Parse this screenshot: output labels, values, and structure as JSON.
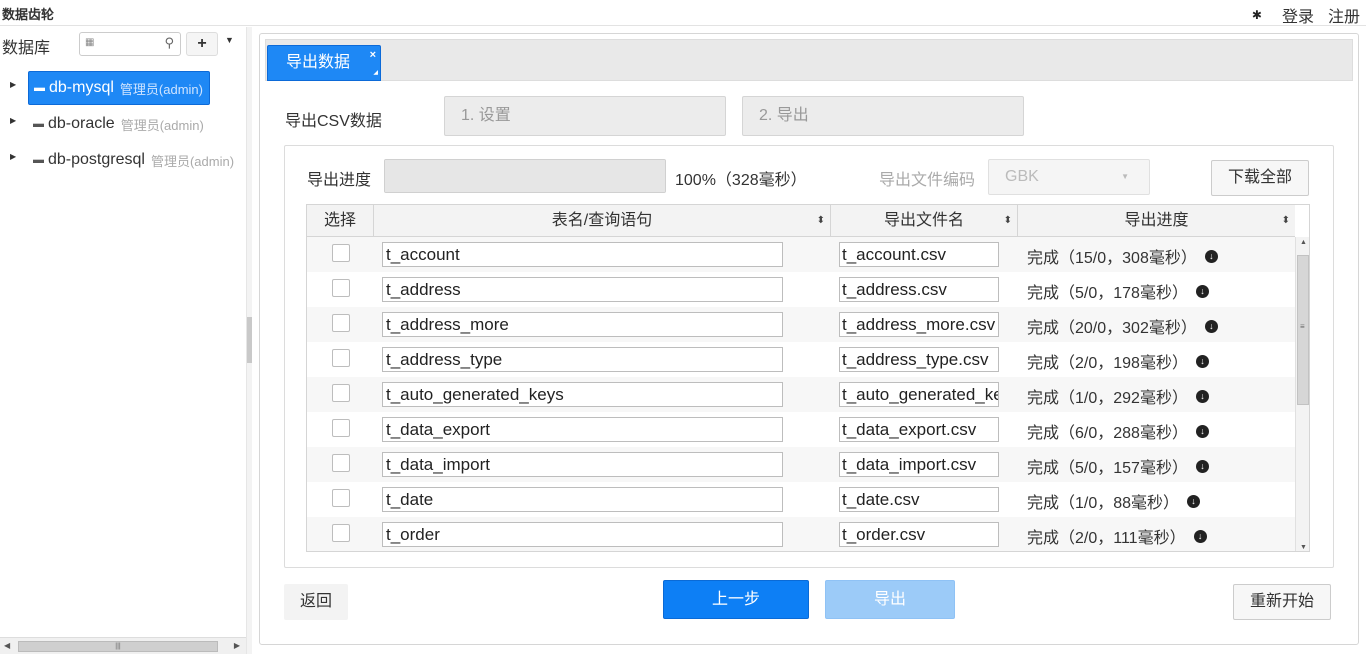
{
  "app_title": "数据齿轮",
  "top_right": {
    "gear_icon": "gear-icon",
    "login": "登录",
    "register": "注册"
  },
  "sidebar": {
    "label": "数据库",
    "search_placeholder": "",
    "add_label": "+",
    "databases": [
      {
        "name": "db-mysql",
        "role": "管理员(admin)",
        "active": true
      },
      {
        "name": "db-oracle",
        "role": "管理员(admin)",
        "active": false
      },
      {
        "name": "db-postgresql",
        "role": "管理员(admin)",
        "active": false
      }
    ]
  },
  "tab": {
    "label": "导出数据",
    "close": "×"
  },
  "export": {
    "title": "导出CSV数据",
    "steps": [
      "1. 设置",
      "2. 导出"
    ],
    "progress_label": "导出进度",
    "progress_percent": 100,
    "progress_text": "100%（328毫秒）",
    "encoding_label": "导出文件编码",
    "encoding_value": "GBK",
    "download_all": "下载全部"
  },
  "grid": {
    "columns": [
      "选择",
      "表名/查询语句",
      "导出文件名",
      "导出进度"
    ],
    "rows": [
      {
        "name": "t_account",
        "file": "t_account.csv",
        "status": "完成（15/0，308毫秒）"
      },
      {
        "name": "t_address",
        "file": "t_address.csv",
        "status": "完成（5/0，178毫秒）"
      },
      {
        "name": "t_address_more",
        "file": "t_address_more.csv",
        "status": "完成（20/0，302毫秒）"
      },
      {
        "name": "t_address_type",
        "file": "t_address_type.csv",
        "status": "完成（2/0，198毫秒）"
      },
      {
        "name": "t_auto_generated_keys",
        "file": "t_auto_generated_keys.csv",
        "status": "完成（1/0，292毫秒）"
      },
      {
        "name": "t_data_export",
        "file": "t_data_export.csv",
        "status": "完成（6/0，288毫秒）"
      },
      {
        "name": "t_data_import",
        "file": "t_data_import.csv",
        "status": "完成（5/0，157毫秒）"
      },
      {
        "name": "t_date",
        "file": "t_date.csv",
        "status": "完成（1/0，88毫秒）"
      },
      {
        "name": "t_order",
        "file": "t_order.csv",
        "status": "完成（2/0，111毫秒）"
      }
    ]
  },
  "buttons": {
    "back": "返回",
    "prev": "上一步",
    "export": "导出",
    "restart": "重新开始"
  },
  "colors": {
    "accent": "#1e88f5",
    "primary_button": "#0d7ff5",
    "disabled_button": "#9ccbf8"
  }
}
